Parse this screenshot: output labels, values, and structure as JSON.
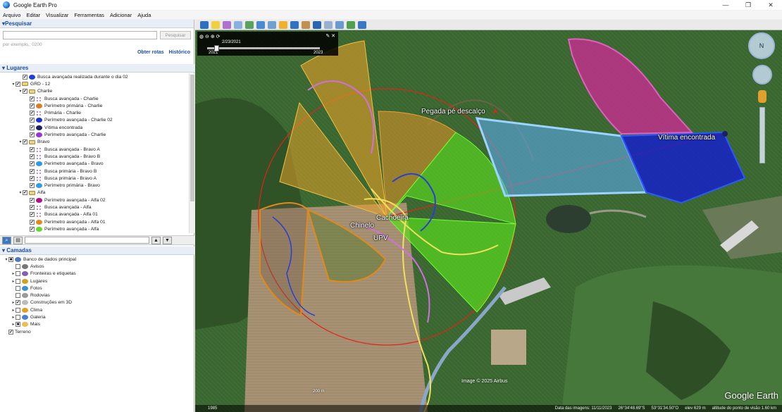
{
  "window": {
    "title": "Google Earth Pro",
    "controls": [
      "—",
      "❐",
      "✕"
    ]
  },
  "menu": [
    "Arquivo",
    "Editar",
    "Visualizar",
    "Ferramentas",
    "Adicionar",
    "Ajuda"
  ],
  "search": {
    "header": "▾Pesquisar",
    "button": "Pesquisar",
    "hint": "por exemplo,: 0200",
    "links": [
      "Obter rotas",
      "Histórico"
    ]
  },
  "places": {
    "header": "▾ Lugares",
    "rows": [
      {
        "depth": 2,
        "label": "Busca avançada realizada durante o dia 02",
        "icon": "#1e3fd8",
        "checked": true,
        "twisty": ""
      },
      {
        "depth": 1,
        "label": "GRD - 12",
        "icon": "folder",
        "checked": true,
        "twisty": "▾"
      },
      {
        "depth": 2,
        "label": "Charlie",
        "icon": "folder",
        "checked": true,
        "twisty": "▾"
      },
      {
        "depth": 3,
        "label": "Busca avançada - Charlie",
        "icon": "dots",
        "checked": true,
        "twisty": ""
      },
      {
        "depth": 3,
        "label": "Perímetro primária - Charlie",
        "icon": "#e07a22",
        "checked": true,
        "twisty": ""
      },
      {
        "depth": 3,
        "label": "Primária - Charlie",
        "icon": "dots",
        "checked": true,
        "twisty": ""
      },
      {
        "depth": 3,
        "label": "Perímetro avançada - Charlie 02",
        "icon": "#1f2fd0",
        "checked": true,
        "twisty": ""
      },
      {
        "depth": 3,
        "label": "Vítima encontrada",
        "icon": "#1a2060",
        "checked": true,
        "twisty": ""
      },
      {
        "depth": 3,
        "label": "Perímetro avançada - Charlie",
        "icon": "#9c2fd6",
        "checked": true,
        "twisty": ""
      },
      {
        "depth": 2,
        "label": "Bravo",
        "icon": "folder",
        "checked": true,
        "twisty": "▾"
      },
      {
        "depth": 3,
        "label": "Busca avançada - Bravo A",
        "icon": "dots",
        "checked": true,
        "twisty": ""
      },
      {
        "depth": 3,
        "label": "Busca avançada - Bravo B",
        "icon": "dots",
        "checked": true,
        "twisty": ""
      },
      {
        "depth": 3,
        "label": "Perímetro avançada - Bravo",
        "icon": "#2a9be0",
        "checked": true,
        "twisty": ""
      },
      {
        "depth": 3,
        "label": "Busca primária - Bravo B",
        "icon": "dots",
        "checked": true,
        "twisty": ""
      },
      {
        "depth": 3,
        "label": "Busca primária - Bravo A",
        "icon": "dots",
        "checked": true,
        "twisty": ""
      },
      {
        "depth": 3,
        "label": "Perímetro primária - Bravo",
        "icon": "#2f9ce5",
        "checked": true,
        "twisty": ""
      },
      {
        "depth": 2,
        "label": "Alfa",
        "icon": "folder",
        "checked": true,
        "twisty": "▾"
      },
      {
        "depth": 3,
        "label": "Perímetro avançada - Alfa 02",
        "icon": "#b0108a",
        "checked": true,
        "twisty": ""
      },
      {
        "depth": 3,
        "label": "Busca avançada - Alfa",
        "icon": "dots",
        "checked": true,
        "twisty": ""
      },
      {
        "depth": 3,
        "label": "Busca avançada - Alfa 01",
        "icon": "dots",
        "checked": true,
        "twisty": ""
      },
      {
        "depth": 3,
        "label": "Perímetro avançada - Alfa 01",
        "icon": "#e08a1a",
        "checked": true,
        "twisty": ""
      },
      {
        "depth": 3,
        "label": "Perímetro avançada - Alfa",
        "icon": "#5fdc2a",
        "checked": true,
        "twisty": ""
      }
    ]
  },
  "layers": {
    "header": "▾ Camadas",
    "rows": [
      {
        "depth": 0,
        "label": "Banco de dados principal",
        "icon": "#4f7ac0",
        "checked": "■",
        "twisty": "▾"
      },
      {
        "depth": 1,
        "label": "Avisos",
        "icon": "#777",
        "checked": "",
        "twisty": ""
      },
      {
        "depth": 1,
        "label": "Fronteiras e etiquetas",
        "icon": "#8060b0",
        "checked": "",
        "twisty": "▸"
      },
      {
        "depth": 1,
        "label": "Lugares",
        "icon": "#d0a020",
        "checked": "",
        "twisty": "▸"
      },
      {
        "depth": 1,
        "label": "Fotos",
        "icon": "#3a90d0",
        "checked": "",
        "twisty": ""
      },
      {
        "depth": 1,
        "label": "Rodovias",
        "icon": "#999",
        "checked": "",
        "twisty": ""
      },
      {
        "depth": 1,
        "label": "Construções em 3D",
        "icon": "#bbb",
        "checked": "✔",
        "twisty": "▸"
      },
      {
        "depth": 1,
        "label": "Clima",
        "icon": "#e0a020",
        "checked": "",
        "twisty": "▸"
      },
      {
        "depth": 1,
        "label": "Galeria",
        "icon": "#4a80d0",
        "checked": "",
        "twisty": "▸"
      },
      {
        "depth": 1,
        "label": "Mais",
        "icon": "#e8c050",
        "checked": "■",
        "twisty": "▸"
      },
      {
        "depth": 0,
        "label": "Terreno",
        "icon": "none",
        "checked": "✔",
        "twisty": ""
      }
    ]
  },
  "history": {
    "date": "2/23/2021",
    "start": "2021",
    "end": "2023",
    "position": 0.06
  },
  "map_labels": {
    "pegada": "Pegada pé descalço",
    "vitima": "Vítima encontrada",
    "chinelo": "Chinelo",
    "cachoeira": "Cachoeira",
    "upv": "UPV"
  },
  "watermarks": {
    "image_credit": "Image © 2025 Airbus",
    "brand": "Google Earth",
    "scale": "200 m"
  },
  "status": {
    "tour_btn": "1985",
    "imagery_date": "Data das imagens: 11/11/2023",
    "lat": "26°34'48.69\"S",
    "lon": "53°31'34.50\"O",
    "elev": "elev   629 m",
    "eye": "altitude do ponto de visão   1.60 km"
  }
}
